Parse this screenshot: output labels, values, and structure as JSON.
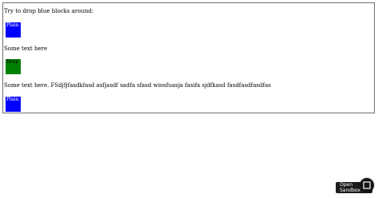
{
  "demo": {
    "intro_text": "Try to drop blue blocks around:",
    "paragraphs": [
      "Some text here",
      "Some text here. FSdjfjfasdkfasd asfjasdf sadfa sfasd wiosfuasja fasifa sjdfkasd fasdfasdfasdfas"
    ],
    "blocks": [
      {
        "label": "Plain",
        "color": "#0000ff"
      },
      {
        "label": "Drop",
        "color": "#008000"
      },
      {
        "label": "Plain",
        "color": "#0000ff"
      }
    ]
  },
  "sandbox": {
    "button_label": "Open Sandbox",
    "icon": "sandbox-icon"
  }
}
